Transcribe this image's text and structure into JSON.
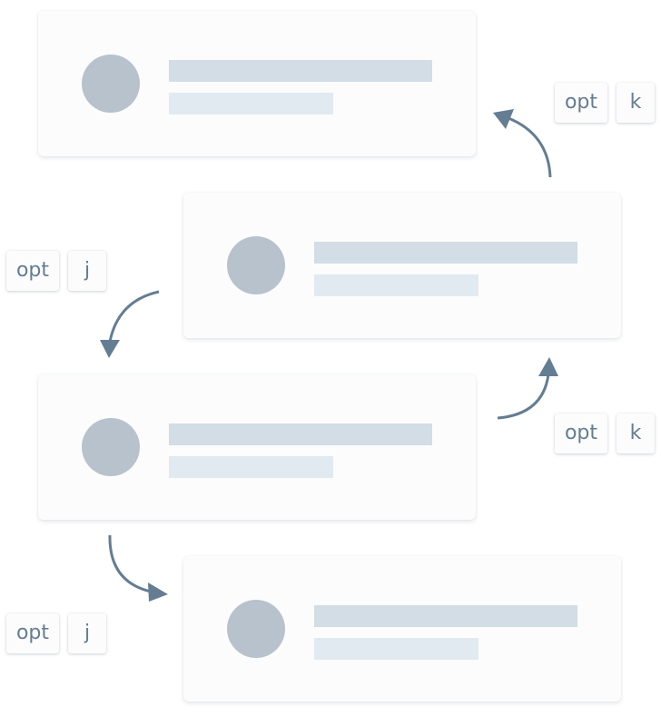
{
  "colors": {
    "avatar": "#b7c2cc",
    "primary_line": "#d2dde5",
    "secondary_line": "#e1eaf1",
    "arrow": "#647d93",
    "key_text": "#647d93"
  },
  "cards": [
    {
      "avatar_icon": "avatar-circle"
    },
    {
      "avatar_icon": "avatar-circle"
    },
    {
      "avatar_icon": "avatar-circle"
    },
    {
      "avatar_icon": "avatar-circle"
    }
  ],
  "shortcuts": [
    {
      "modifier": "opt",
      "key": "k"
    },
    {
      "modifier": "opt",
      "key": "j"
    },
    {
      "modifier": "opt",
      "key": "k"
    },
    {
      "modifier": "opt",
      "key": "j"
    }
  ]
}
